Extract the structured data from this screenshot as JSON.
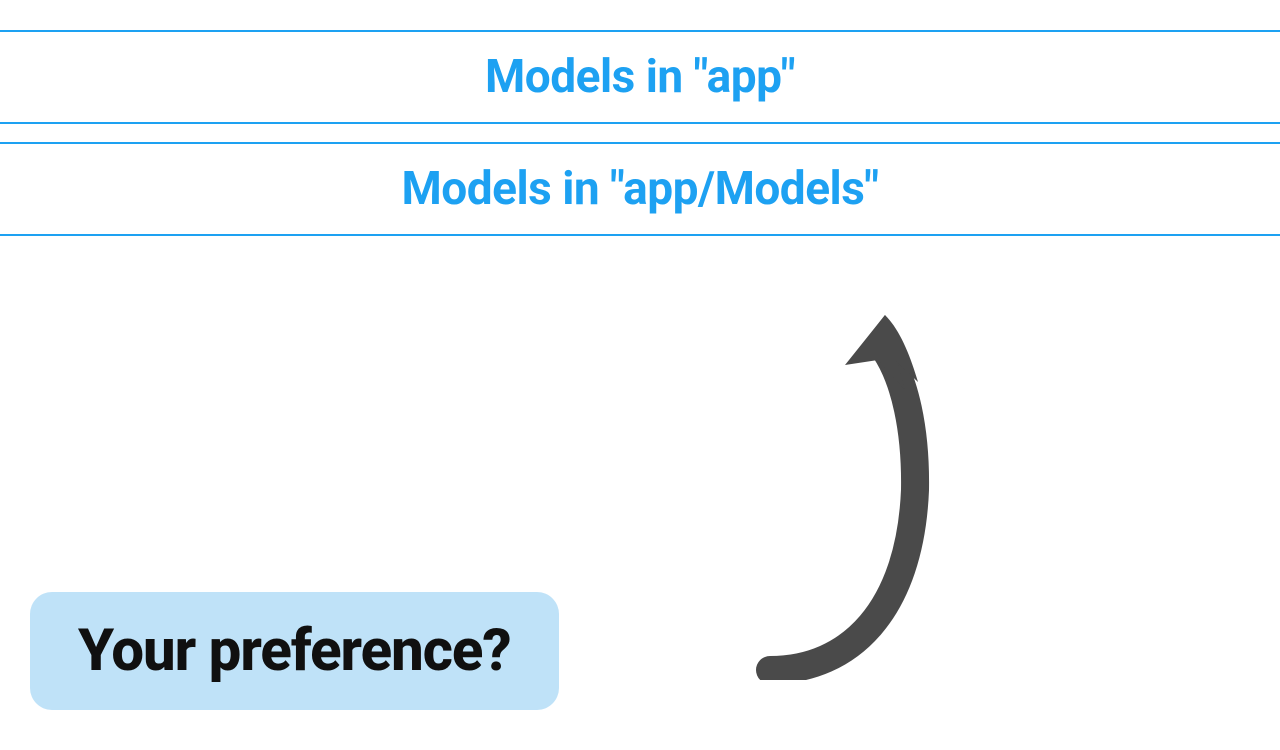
{
  "options": {
    "first": "Models in \"app\"",
    "second": "Models in \"app/Models\""
  },
  "prompt": {
    "label": "Your preference?"
  },
  "colors": {
    "accent": "#1da1f2",
    "tag_bg": "#bfe2f8",
    "arrow": "#4a4a4a"
  }
}
